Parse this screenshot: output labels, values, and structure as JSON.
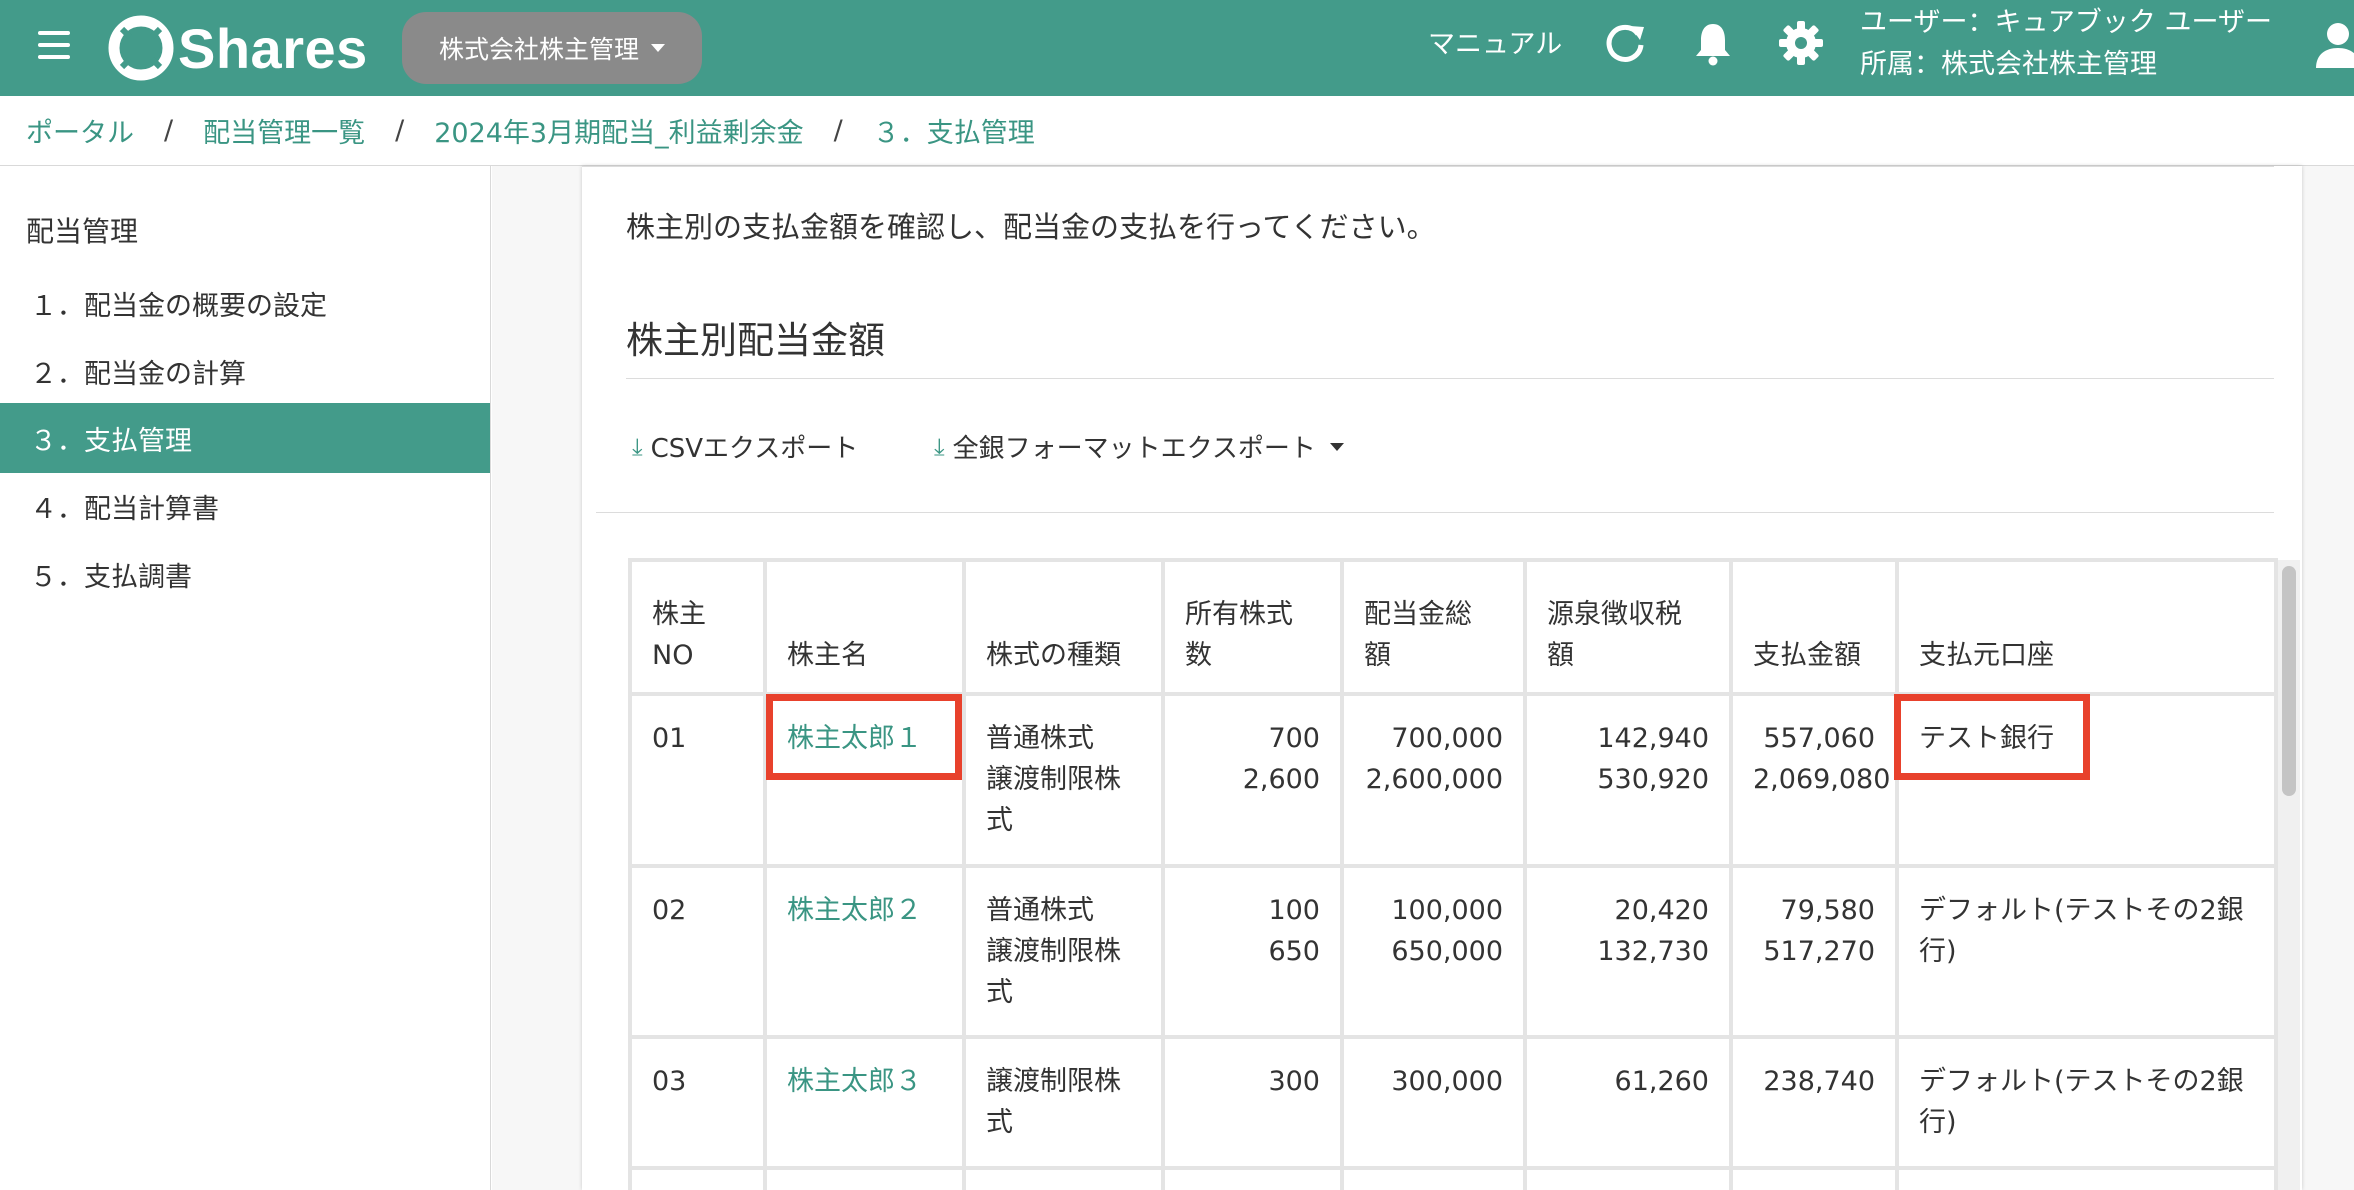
{
  "header": {
    "logo_text": "Shares",
    "company": "株式会社株主管理",
    "manual": "マニュアル",
    "user_line1": "ユーザー：キュアブック ユーザー",
    "user_line2": "所属：株式会社株主管理",
    "icons": [
      "menu-icon",
      "refresh-icon",
      "bell-icon",
      "gear-icon",
      "user-icon"
    ]
  },
  "breadcrumb": {
    "items": [
      "ポータル",
      "配当管理一覧",
      "2024年3月期配当_利益剰余金",
      "３．支払管理"
    ],
    "separator": "/"
  },
  "sidebar": {
    "title": "配当管理",
    "items": [
      "１．配当金の概要の設定",
      "２．配当金の計算",
      "３．支払管理",
      "４．配当計算書",
      "５．支払調書"
    ],
    "active_index": 2
  },
  "main": {
    "description": "株主別の支払金額を確認し、配当金の支払を行ってください。",
    "section_title": "株主別配当金額",
    "export_csv": "CSVエクスポート",
    "export_zengin": "全銀フォーマットエクスポート",
    "download_glyph": "⤓"
  },
  "table": {
    "headers": {
      "no": [
        "株主",
        "NO"
      ],
      "name": [
        "株主名"
      ],
      "type": [
        "株式の種類"
      ],
      "shares": [
        "所有株式",
        "数"
      ],
      "total": [
        "配当金総",
        "額"
      ],
      "tax": [
        "源泉徴収税",
        "額"
      ],
      "pay": [
        "支払金額"
      ],
      "account": [
        "支払元口座"
      ]
    },
    "rows": [
      {
        "no": "01",
        "name": "株主太郎１",
        "type": [
          "普通株式",
          "譲渡制限株",
          "式"
        ],
        "shares": [
          "700",
          "2,600"
        ],
        "total": [
          "700,000",
          "2,600,000"
        ],
        "tax": [
          "142,940",
          "530,920"
        ],
        "pay": [
          "557,060",
          "2,069,080"
        ],
        "account": [
          "テスト銀行"
        ]
      },
      {
        "no": "02",
        "name": "株主太郎２",
        "type": [
          "普通株式",
          "譲渡制限株",
          "式"
        ],
        "shares": [
          "100",
          "650"
        ],
        "total": [
          "100,000",
          "650,000"
        ],
        "tax": [
          "20,420",
          "132,730"
        ],
        "pay": [
          "79,580",
          "517,270"
        ],
        "account": [
          "デフォルト(テストその2銀",
          "行)"
        ]
      },
      {
        "no": "03",
        "name": "株主太郎３",
        "type": [
          "譲渡制限株",
          "式"
        ],
        "shares": [
          "300"
        ],
        "total": [
          "300,000"
        ],
        "tax": [
          "61,260"
        ],
        "pay": [
          "238,740"
        ],
        "account": [
          "デフォルト(テストその2銀",
          "行)"
        ]
      }
    ]
  },
  "colors": {
    "brand": "#439b8a",
    "link": "#3a9583",
    "highlight": "#e8412c",
    "company_pill": "#8a8a8a"
  }
}
